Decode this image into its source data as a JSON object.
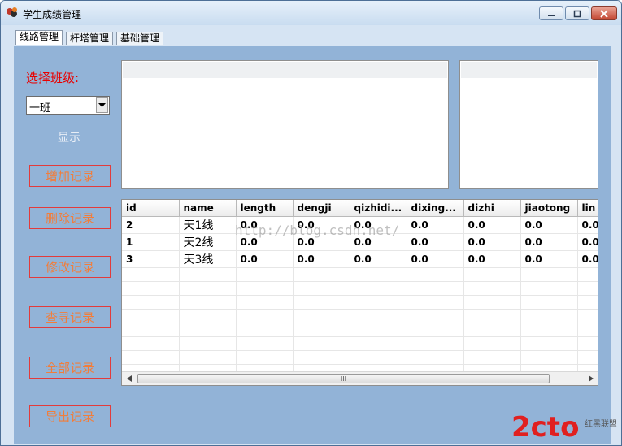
{
  "window": {
    "title": "学生成绩管理"
  },
  "tabs": [
    {
      "label": "线路管理",
      "active": true
    },
    {
      "label": "杆塔管理",
      "active": false
    },
    {
      "label": "基础管理",
      "active": false
    }
  ],
  "sidebar": {
    "select_label": "选择班级:",
    "class_select": {
      "value": "一班"
    },
    "show_label": "显示",
    "buttons": [
      "增加记录",
      "删除记录",
      "修改记录",
      "查寻记录",
      "全部记录",
      "导出记录"
    ]
  },
  "grid": {
    "columns": [
      "id",
      "name",
      "length",
      "dengji",
      "qizhidi...",
      "dixing...",
      "dizhi",
      "jiaotong",
      "lin"
    ],
    "rows": [
      [
        "2",
        "天1线",
        "0.0",
        "0.0",
        "0.0",
        "0.0",
        "0.0",
        "0.0",
        "0.0"
      ],
      [
        "1",
        "天2线",
        "0.0",
        "0.0",
        "0.0",
        "0.0",
        "0.0",
        "0.0",
        "0.0"
      ],
      [
        "3",
        "天3线",
        "0.0",
        "0.0",
        "0.0",
        "0.0",
        "0.0",
        "0.0",
        "0.0"
      ]
    ],
    "scroll_thumb_glyph": "III"
  },
  "watermark": "http://blog.csdn.net/",
  "logo": {
    "text": "2cto",
    "sub": "红黑联盟"
  },
  "colors": {
    "client_bg": "#92b3d7",
    "label_red": "#e80000",
    "button_border": "#e33b3b",
    "button_text": "#f27d3a",
    "logo_red": "#e02020"
  }
}
